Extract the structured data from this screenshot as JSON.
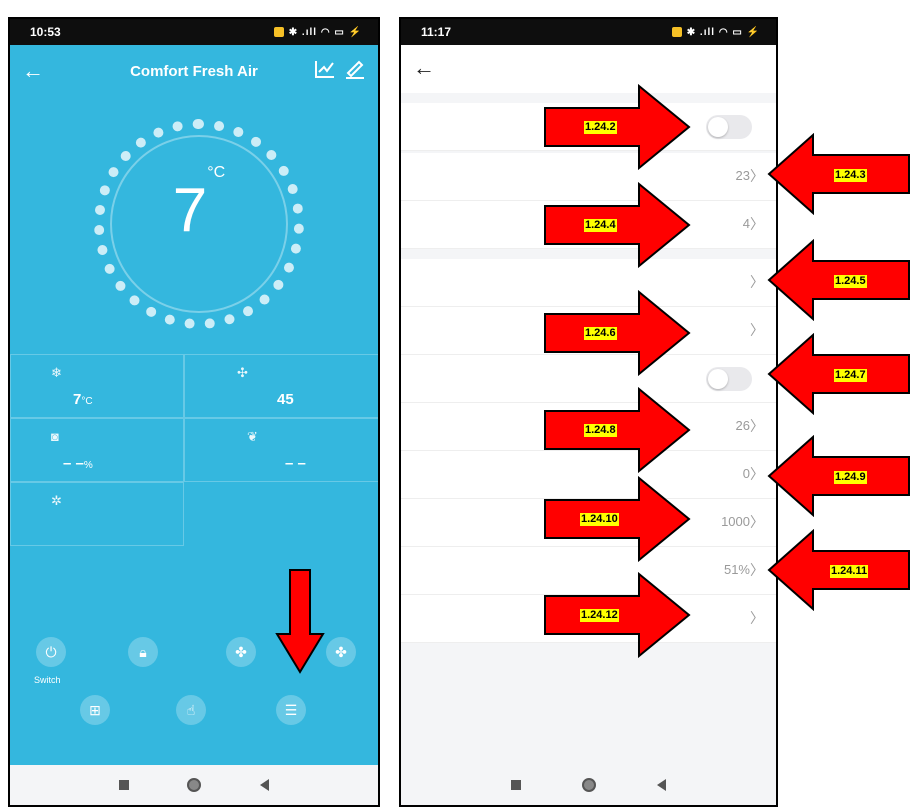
{
  "left_phone": {
    "status_time": "10:53",
    "title": "Comfort  Fresh Air",
    "dial_temp_value": "7",
    "dial_temp_unit": "°C",
    "cells": [
      {
        "icon": "humidity-icon",
        "value": "7",
        "unit": "°C"
      },
      {
        "icon": "fan-speed-icon",
        "value": "45",
        "unit": ""
      },
      {
        "icon": "filter-icon",
        "value": "– –",
        "unit": "%"
      },
      {
        "icon": "leaf-icon",
        "value": "– –",
        "unit": ""
      },
      {
        "icon": "mode-icon",
        "value": "",
        "unit": ""
      }
    ],
    "switch_label": "Switch"
  },
  "right_phone": {
    "status_time": "11:17",
    "rows": [
      {
        "type": "toggle",
        "value": ""
      },
      {
        "type": "value",
        "value": "23"
      },
      {
        "type": "value",
        "value": "4"
      },
      {
        "type": "value",
        "value": ""
      },
      {
        "type": "value",
        "value": ""
      },
      {
        "type": "toggle",
        "value": ""
      },
      {
        "type": "value",
        "value": "26"
      },
      {
        "type": "value",
        "value": "0"
      },
      {
        "type": "value",
        "value": "1000"
      },
      {
        "type": "value",
        "value": "51%"
      },
      {
        "type": "value",
        "value": ""
      }
    ]
  },
  "annotations": {
    "labels": [
      "1.24.2",
      "1.24.3",
      "1.24.4",
      "1.24.5",
      "1.24.6",
      "1.24.7",
      "1.24.8",
      "1.24.9",
      "1.24.10",
      "1.24.11",
      "1.24.12"
    ]
  },
  "colors": {
    "app_blue": "#34b7de",
    "arrow_red": "#ff0000",
    "label_yellow": "#ffff00"
  }
}
